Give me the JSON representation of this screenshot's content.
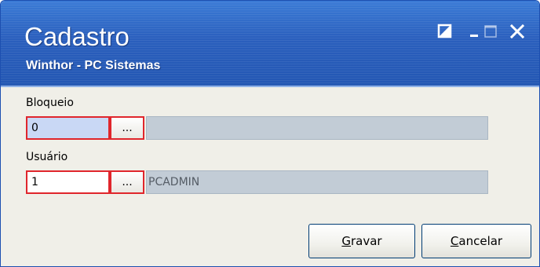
{
  "window": {
    "title": "Cadastro",
    "subtitle": "Winthor - PC Sistemas"
  },
  "title_controls": {
    "restore_icon": "restore-icon",
    "minimize_icon": "minimize-icon",
    "maximize_icon": "maximize-icon",
    "close_icon": "close-icon"
  },
  "form": {
    "bloqueio": {
      "label": "Bloqueio",
      "code_value": "0",
      "browse_label": "...",
      "description": ""
    },
    "usuario": {
      "label": "Usuário",
      "code_value": "1",
      "browse_label": "...",
      "description": "PCADMIN"
    }
  },
  "buttons": {
    "gravar": {
      "accel": "G",
      "rest": "ravar"
    },
    "cancelar": {
      "accel": "C",
      "rest": "ancelar"
    }
  },
  "colors": {
    "titlebar": "#2a5fbd",
    "highlight": "#e0262c",
    "readonly_field": "#c2ccd6",
    "window_bg": "#f0efe8"
  }
}
